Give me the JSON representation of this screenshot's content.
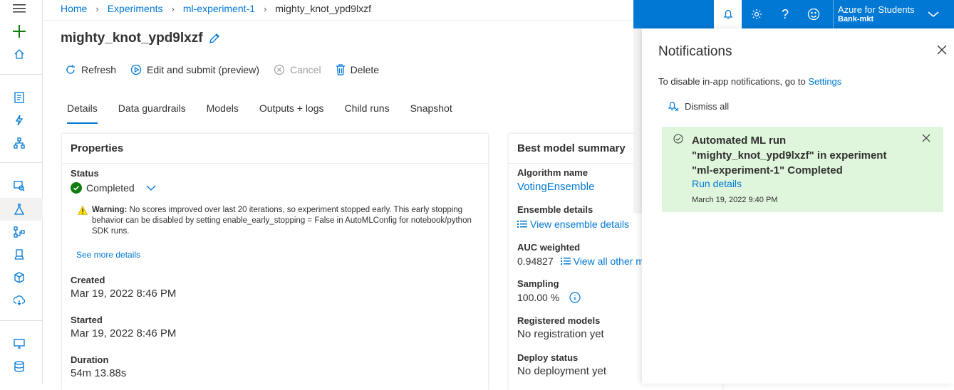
{
  "breadcrumb": {
    "home": "Home",
    "experiments": "Experiments",
    "experiment": "ml-experiment-1",
    "run": "mighty_knot_ypd9lxzf"
  },
  "page_title": "mighty_knot_ypd9lxzf",
  "toolbar": {
    "refresh": "Refresh",
    "edit": "Edit and submit (preview)",
    "cancel": "Cancel",
    "delete": "Delete"
  },
  "tabs": [
    "Details",
    "Data guardrails",
    "Models",
    "Outputs + logs",
    "Child runs",
    "Snapshot"
  ],
  "properties": {
    "title": "Properties",
    "status_label": "Status",
    "status_value": "Completed",
    "warning": "No scores improved over last 20 iterations, so experiment stopped early. This early stopping behavior can be disabled by setting enable_early_stopping = False in AutoMLConfig for notebook/python SDK runs.",
    "warning_prefix": "Warning:",
    "see_more": "See more details",
    "created_label": "Created",
    "created_value": "Mar 19, 2022 8:46 PM",
    "started_label": "Started",
    "started_value": "Mar 19, 2022 8:46 PM",
    "duration_label": "Duration",
    "duration_value": "54m 13.88s"
  },
  "best_model": {
    "title": "Best model summary",
    "algorithm_label": "Algorithm name",
    "algorithm_value": "VotingEnsemble",
    "ensemble_label": "Ensemble details",
    "ensemble_link": "View ensemble details",
    "auc_label": "AUC weighted",
    "auc_value": "0.94827",
    "metrics_link": "View all other metrics",
    "sampling_label": "Sampling",
    "sampling_value": "100.00 %",
    "registered_label": "Registered models",
    "registered_value": "No registration yet",
    "deploy_label": "Deploy status",
    "deploy_value": "No deployment yet"
  },
  "topbar": {
    "account_name": "Azure for Students",
    "account_sub": "Bank-mkt",
    "bg": "#0078d4"
  },
  "notifications": {
    "title": "Notifications",
    "disable_text": "To disable in-app notifications, go to ",
    "settings_link": "Settings",
    "dismiss_all": "Dismiss all",
    "item": {
      "line1": "Automated ML run",
      "line2": "\"mighty_knot_ypd9lxzf\" in experiment",
      "line3": "\"ml-experiment-1\" Completed",
      "link": "Run details",
      "time": "March 19, 2022 9:40 PM",
      "bg": "#dff6dd"
    }
  }
}
